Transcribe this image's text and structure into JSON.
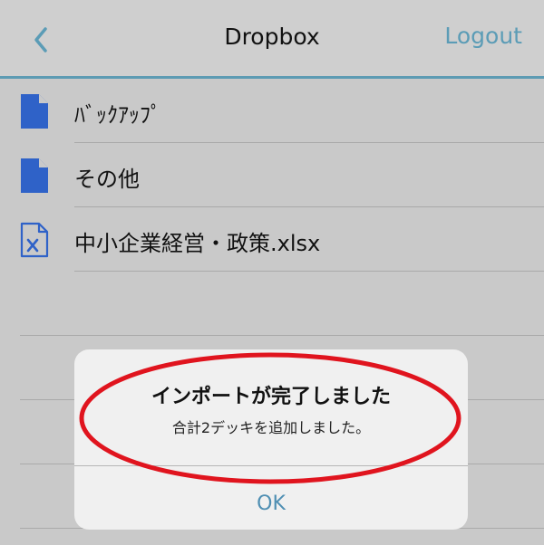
{
  "navbar": {
    "title": "Dropbox",
    "logout_label": "Logout",
    "back_icon": "chevron-left-icon"
  },
  "files": [
    {
      "name": "ﾊﾞｯｸｱｯﾌﾟ",
      "icon": "document-icon"
    },
    {
      "name": "その他",
      "icon": "document-icon"
    },
    {
      "name": "中小企業経営・政策.xlsx",
      "icon": "excel-file-icon"
    }
  ],
  "dialog": {
    "title": "インポートが完了しました",
    "message": "合計2デッキを追加しました。",
    "ok_label": "OK"
  },
  "colors": {
    "accent": "#5b9cb6",
    "file_icon": "#2f62c8",
    "annotation": "#e0141e"
  }
}
